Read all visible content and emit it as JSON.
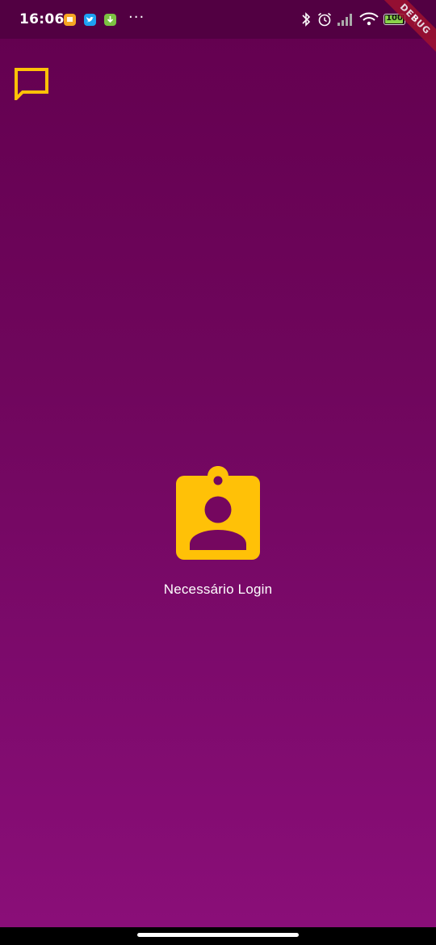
{
  "status_bar": {
    "time": "16:06",
    "more_indicator": "···",
    "battery_level": "100",
    "battery_percent": 100,
    "notifications": [
      {
        "icon": "flag-notification-icon",
        "color": "#f5a623"
      },
      {
        "icon": "twitter-notification-icon",
        "color": "#1da1f2"
      },
      {
        "icon": "download-notification-icon",
        "color": "#7cc242"
      }
    ],
    "system_icons": [
      "bluetooth-icon",
      "alarm-icon",
      "signal-icon",
      "wifi-icon",
      "battery-icon",
      "charging-icon"
    ]
  },
  "debug_banner": "DEBUG",
  "toolbar": {
    "chat_icon": "chat-bubble-icon"
  },
  "main": {
    "icon": "contact-badge-icon",
    "message": "Necessário Login"
  },
  "colors": {
    "accent": "#ffc107",
    "background_top": "#63004f",
    "background_bottom": "#8a0e78",
    "status_bar": "#520042",
    "text": "#ffffff"
  }
}
